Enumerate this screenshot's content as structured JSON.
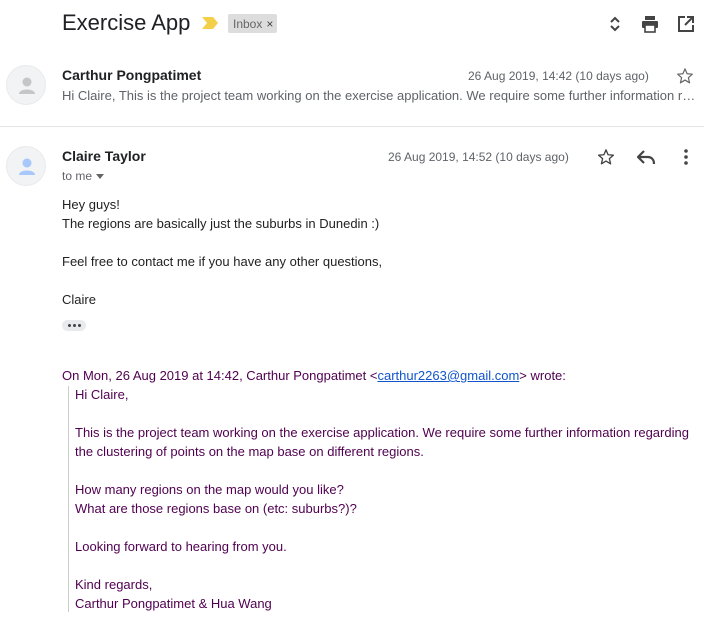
{
  "header": {
    "subject": "Exercise App",
    "label_chip": "Inbox",
    "label_remove": "×",
    "icons": [
      "expand-collapse-icon",
      "print-icon",
      "open-in-new-window-icon"
    ]
  },
  "message1": {
    "sender": "Carthur Pongpatimet",
    "date": "26 Aug 2019, 14:42 (10 days ago)",
    "snippet": "Hi Claire, This is the project team working on the exercise application. We require some further information regarding the clustering of points"
  },
  "message2": {
    "sender": "Claire Taylor",
    "date": "26 Aug 2019, 14:52 (10 days ago)",
    "recipient": "to me",
    "body": [
      "Hey guys!",
      "The regions are basically just the suburbs in Dunedin :)",
      "Feel free to contact me if you have any other questions,",
      "Claire"
    ],
    "quote": {
      "intro_prefix": "On Mon, 26 Aug 2019 at 14:42, Carthur Pongpatimet <",
      "email": "carthur2263@gmail.com",
      "intro_suffix": "> wrote:",
      "lines": [
        "Hi Claire,",
        "This is the project team working on the exercise application. We require some further information regarding",
        "the clustering of points on the map base on different regions.",
        "How many regions on the map would you like?",
        "What are those regions base on (etc: suburbs?)?",
        "Looking forward to hearing from you.",
        "Kind regards,",
        "Carthur Pongpatimet & Hua Wang"
      ]
    }
  },
  "colors": {
    "label_arrow": "#f4cf4a",
    "quote_text": "#500050",
    "link": "#1155cc",
    "avatar_bg": "#f1f3f4",
    "avatar_person_grey": "#c4c7c5",
    "avatar_person_blue": "#a8c7fa"
  }
}
